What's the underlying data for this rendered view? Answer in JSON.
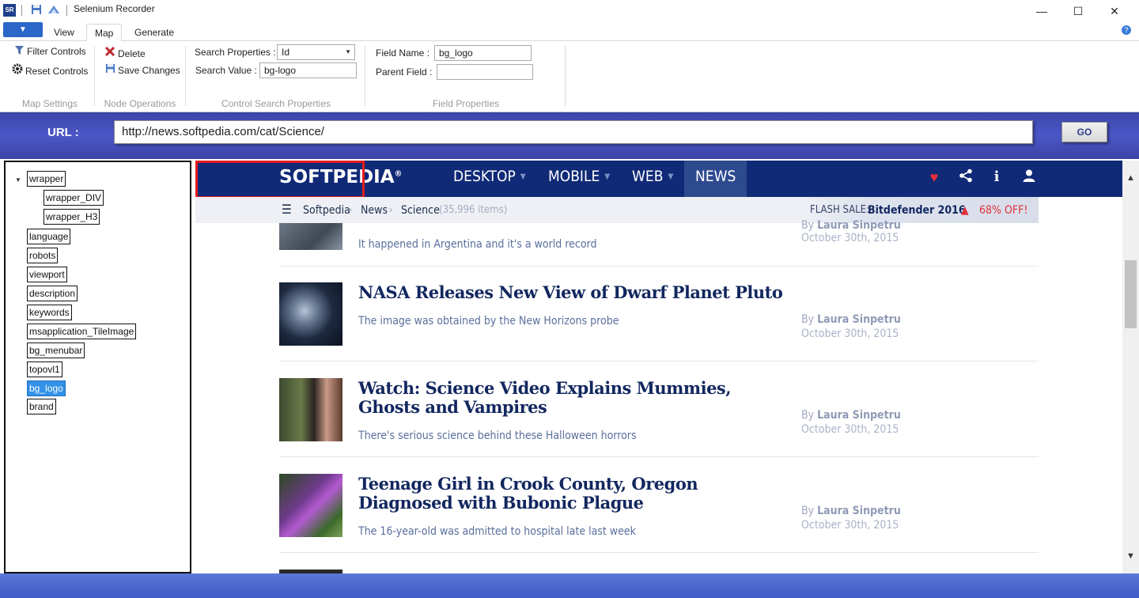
{
  "window": {
    "title": "Selenium Recorder",
    "app_icon_text": "SR",
    "minimize": "—",
    "maximize": "☐",
    "close": "✕"
  },
  "ribbon_tabs": {
    "file_arrow": "▼",
    "tabs": [
      {
        "label": "View",
        "active": false
      },
      {
        "label": "Map",
        "active": true
      },
      {
        "label": "Generate",
        "active": false
      }
    ],
    "help": "?"
  },
  "map_settings": {
    "filter_controls": "Filter Controls",
    "reset_controls": "Reset Controls",
    "group_label": "Map Settings"
  },
  "node_operations": {
    "delete": "Delete",
    "save_changes": "Save Changes",
    "group_label": "Node Operations"
  },
  "control_search": {
    "search_properties_label": "Search Properties :",
    "search_properties_value": "Id",
    "search_value_label": "Search Value :",
    "search_value": "bg-logo",
    "group_label": "Control Search Properties"
  },
  "field_properties": {
    "field_name_label": "Field Name :",
    "field_name_value": "bg_logo",
    "parent_field_label": "Parent Field :",
    "parent_field_value": "",
    "group_label": "Field Properties"
  },
  "url_bar": {
    "label": "URL :",
    "value": "http://news.softpedia.com/cat/Science/",
    "go": "GO"
  },
  "tree": {
    "expander": "▼",
    "root": "wrapper",
    "children": [
      "wrapper_DIV",
      "wrapper_H3"
    ],
    "nodes": [
      "language",
      "robots",
      "viewport",
      "description",
      "keywords",
      "msapplication_TileImage",
      "bg_menubar",
      "topovl1",
      "bg_logo",
      "brand"
    ],
    "selected": "bg_logo"
  },
  "site": {
    "logo": "SOFTPEDIA",
    "logo_mark": "®",
    "nav": [
      {
        "label": "DESKTOP",
        "caret": "▼"
      },
      {
        "label": "MOBILE",
        "caret": "▼"
      },
      {
        "label": "WEB",
        "caret": "▼"
      },
      {
        "label": "NEWS",
        "caret": ""
      }
    ],
    "icons": [
      "♥",
      "⋖",
      "i",
      "👤"
    ],
    "breadcrumb": {
      "menu_icon": "☰",
      "items": [
        "Softpedia",
        "News",
        "Science"
      ],
      "count": "(35,996 items)",
      "sep": "›"
    },
    "flash": {
      "label": "FLASH SALE:",
      "product": "Bitdefender 2016",
      "warn_icon": "▲",
      "offer": "68% OFF!"
    },
    "articles": [
      {
        "title": "",
        "subtitle": "It happened in Argentina and it's a world record",
        "by": "By",
        "author": "Laura Sinpetru",
        "date": "October 30th, 2015"
      },
      {
        "title": "NASA Releases New View of Dwarf Planet Pluto",
        "subtitle": "The image was obtained by the New Horizons probe",
        "by": "By",
        "author": "Laura Sinpetru",
        "date": "October 30th, 2015"
      },
      {
        "title": "Watch: Science Video Explains Mummies, Ghosts and Vampires",
        "subtitle": "There's serious science behind these Halloween horrors",
        "by": "By",
        "author": "Laura Sinpetru",
        "date": "October 30th, 2015"
      },
      {
        "title": "Teenage Girl in Crook County, Oregon Diagnosed with Bubonic Plague",
        "subtitle": "The 16-year-old was admitted to hospital late last week",
        "by": "By",
        "author": "Laura Sinpetru",
        "date": "October 30th, 2015"
      }
    ]
  },
  "scroll": {
    "up": "▲",
    "down": "▼"
  },
  "colors": {
    "accent": "#2b66c9",
    "url_bar": "#4350b8",
    "site_nav": "#102a77",
    "selection_rect": "#e41b1b",
    "selected_node": "#3391e6"
  }
}
